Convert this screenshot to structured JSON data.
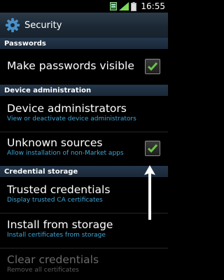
{
  "status_bar": {
    "time": "16:55"
  },
  "header": {
    "title": "Security"
  },
  "sections": {
    "passwords": "Passwords",
    "device_admin": "Device administration",
    "credential": "Credential storage"
  },
  "items": {
    "make_passwords_visible": {
      "title": "Make passwords visible",
      "checked": true
    },
    "device_administrators": {
      "title": "Device administrators",
      "subtitle": "View or deactivate device administrators"
    },
    "unknown_sources": {
      "title": "Unknown sources",
      "subtitle": "Allow installation of non-Market apps",
      "checked": true
    },
    "trusted_credentials": {
      "title": "Trusted credentials",
      "subtitle": "Display trusted CA certificates"
    },
    "install_from_storage": {
      "title": "Install from storage",
      "subtitle": "Install certificates from storage"
    },
    "clear_credentials": {
      "title": "Clear credentials",
      "subtitle": "Remove all certificates",
      "enabled": false
    }
  },
  "colors": {
    "accent": "#3fa6d8",
    "check": "#6cc04a",
    "header_bg": "#1b2733",
    "section_bg": "#1f3042"
  },
  "icons": [
    "notification-icon",
    "signal-icon",
    "battery-icon",
    "gear-icon",
    "checkmark-icon",
    "arrow-up-icon"
  ]
}
